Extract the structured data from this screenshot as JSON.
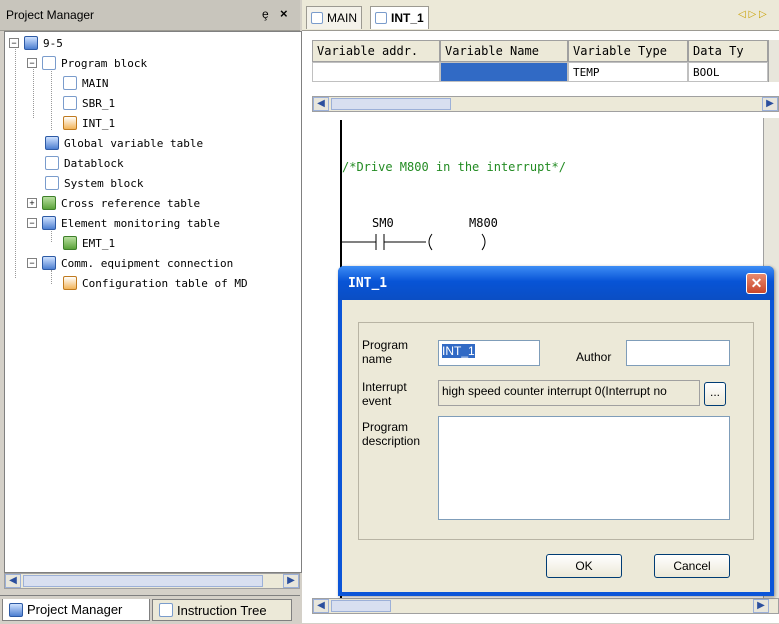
{
  "project_manager": {
    "title": "Project Manager",
    "pin_glyph": "ȩ",
    "close_glyph": "×",
    "tree": [
      {
        "label": "9-5",
        "level": 0,
        "icon": "project-icon"
      },
      {
        "label": "Program block",
        "level": 1,
        "icon": "folder-icon"
      },
      {
        "label": "MAIN",
        "level": 2,
        "icon": "program-icon"
      },
      {
        "label": "SBR_1",
        "level": 2,
        "icon": "program-icon"
      },
      {
        "label": "INT_1",
        "level": 2,
        "icon": "program-icon"
      },
      {
        "label": "Global variable table",
        "level": 1,
        "icon": "variable-table-icon"
      },
      {
        "label": "Datablock",
        "level": 1,
        "icon": "datablock-icon"
      },
      {
        "label": "System block",
        "level": 1,
        "icon": "system-block-icon"
      },
      {
        "label": "Cross reference table",
        "level": 1,
        "icon": "cross-reference-icon"
      },
      {
        "label": "Element monitoring table",
        "level": 1,
        "icon": "monitor-table-icon"
      },
      {
        "label": "EMT_1",
        "level": 2,
        "icon": "monitor-icon"
      },
      {
        "label": "Comm. equipment connection",
        "level": 1,
        "icon": "connection-icon"
      },
      {
        "label": "Configuration table of MD",
        "level": 2,
        "icon": "config-table-icon"
      }
    ],
    "tabs": [
      "Project Manager",
      "Instruction Tree"
    ]
  },
  "editor": {
    "tabs": [
      "MAIN",
      "INT_1"
    ],
    "var_table": {
      "headers": [
        "Variable addr.",
        "Variable Name",
        "Variable Type",
        "Data Ty"
      ],
      "row": [
        "",
        "",
        "TEMP",
        "BOOL"
      ]
    },
    "ladder": {
      "comment": "/*Drive M800 in the interrupt*/",
      "contact": "SM0",
      "coil": "M800"
    }
  },
  "dialog": {
    "title": "INT_1",
    "program_name_label": "Program name",
    "program_name_value": "INT_1",
    "author_label": "Author",
    "author_value": "",
    "interrupt_event_label": "Interrupt event",
    "interrupt_event_value": "high speed counter interrupt 0(Interrupt no",
    "browse_label": "...",
    "program_description_label": "Program description",
    "program_description_value": "",
    "ok_label": "OK",
    "cancel_label": "Cancel"
  }
}
